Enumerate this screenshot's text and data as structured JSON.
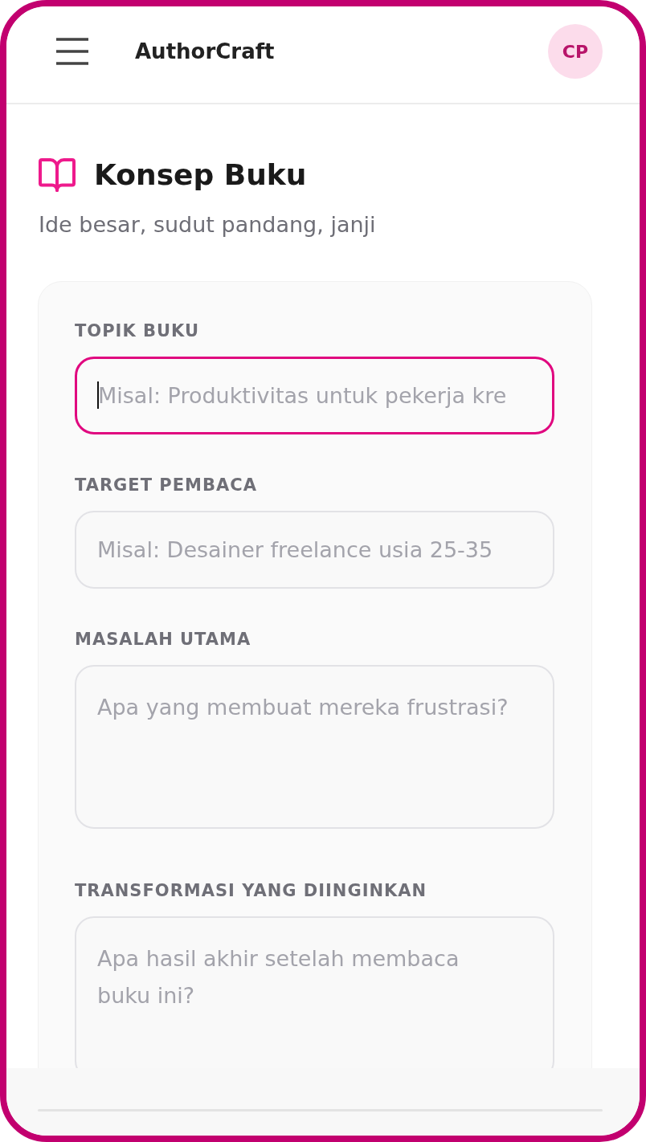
{
  "app_bar": {
    "title": "AuthorCraft",
    "avatar_initials": "CP"
  },
  "page": {
    "title": "Konsep Buku",
    "subtitle": "Ide besar, sudut pandang, janji"
  },
  "form": {
    "fields": [
      {
        "label": "TOPIK BUKU",
        "kind": "input",
        "placeholder": "Misal: Produktivitas untuk pekerja kre",
        "focused": true
      },
      {
        "label": "TARGET PEMBACA",
        "kind": "input",
        "placeholder": "Misal: Desainer freelance usia 25-35",
        "focused": false
      },
      {
        "label": "MASALAH UTAMA",
        "kind": "textarea",
        "placeholder": "Apa yang membuat mereka frustrasi?",
        "focused": false
      },
      {
        "label": "TRANSFORMASI YANG DIINGINKAN",
        "kind": "textarea",
        "placeholder": "Apa hasil akhir setelah membaca buku ini?",
        "focused": false
      }
    ]
  }
}
